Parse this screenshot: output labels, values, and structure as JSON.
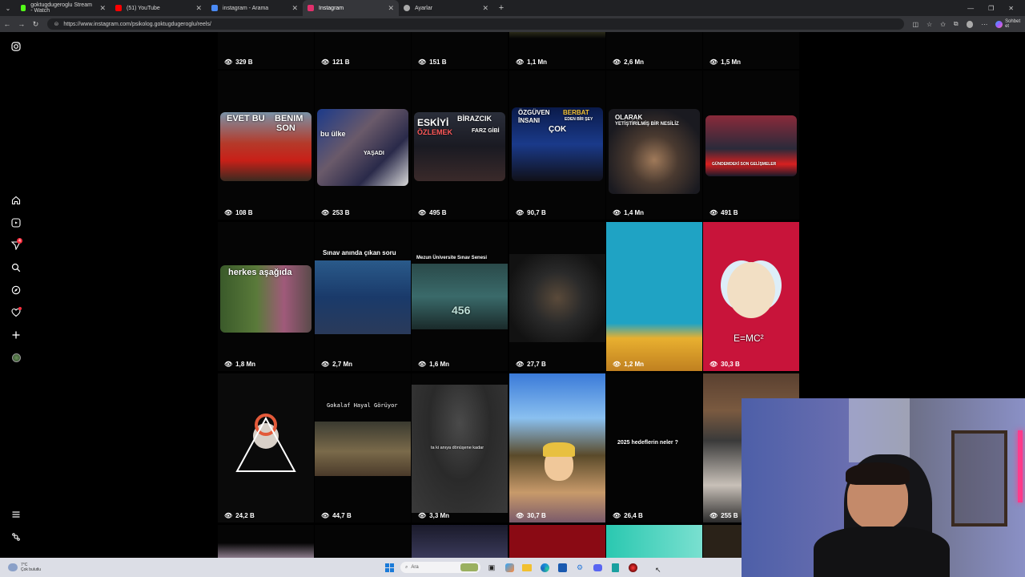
{
  "browser": {
    "tabs": [
      {
        "title": "goktugdugeroglu Stream - Watch",
        "color": "#53fc18"
      },
      {
        "title": "(51) YouTube",
        "color": "#ff0000"
      },
      {
        "title": "instagram - Arama",
        "color": "#4a8af4"
      },
      {
        "title": "Instagram",
        "color": "#e1306c"
      },
      {
        "title": "Ayarlar",
        "color": "#aaaaaa"
      }
    ],
    "url": "https://www.instagram.com/psikolog.goktugdugeroglu/reels/",
    "chat_button": "Sohbet et"
  },
  "sidebar": {
    "notification_count": "4",
    "icons": [
      "instagram-icon",
      "home-icon",
      "reels-icon",
      "direct-icon",
      "search-icon",
      "explore-icon",
      "heart-icon",
      "create-icon",
      "profile-icon",
      "menu-icon",
      "threads-icon"
    ]
  },
  "reels": {
    "row1": [
      "329 B",
      "121 B",
      "151 B",
      "1,1 Mn",
      "2,6 Mn",
      "1,5 Mn"
    ],
    "row2": [
      {
        "views": "108 B",
        "text1": "EVET BU",
        "text2": "BENIM",
        "text3": "SON"
      },
      {
        "views": "253 B",
        "text1": "bu ülke",
        "text2": "YAŞADI"
      },
      {
        "views": "495 B",
        "text1": "ESKİYİ",
        "text2": "BİRAZCIK",
        "text3": "ÖZLEMEK",
        "text4": "FARZ GİBİ"
      },
      {
        "views": "90,7 B",
        "text1": "ÖZGÜVEN",
        "text2": "BERBAT",
        "text3": "İNSANI",
        "text4": "EDEN BİR ŞEY",
        "text5": "ÇOK"
      },
      {
        "views": "1,4 Mn",
        "text1": "OLARAK",
        "text2": "YETİŞTİRİLMİŞ BİR NESİLİZ"
      },
      {
        "views": "491 B",
        "text1": "GÜNDEMDEKİ SON GELİŞMELER"
      }
    ],
    "row3": [
      {
        "views": "1,8 Mn",
        "text1": "herkes aşağıda"
      },
      {
        "views": "2,7 Mn",
        "text1": "Sınav anında çıkan soru"
      },
      {
        "views": "1,6 Mn",
        "text1": "Mezun Üniversite Sınav Senesi",
        "text2": "456"
      },
      {
        "views": "27,7 B"
      },
      {
        "views": "1,2 Mn"
      },
      {
        "views": "30,3 B",
        "text1": "E=MC²"
      }
    ],
    "row4": [
      {
        "views": "24,2 B"
      },
      {
        "views": "44,7 B",
        "text1": "Gokalaf Hayal Görüyor"
      },
      {
        "views": "3,3 Mn",
        "text1": "ta ki anıya dönüşene kadar"
      },
      {
        "views": "30,7 B"
      },
      {
        "views": "26,4 B",
        "text1": "2025 hedeflerin neler ?"
      },
      {
        "views": "255 B"
      }
    ]
  },
  "taskbar": {
    "weather_temp": "7°C",
    "weather_desc": "Çok bulutlu",
    "search_placeholder": "Ara"
  }
}
